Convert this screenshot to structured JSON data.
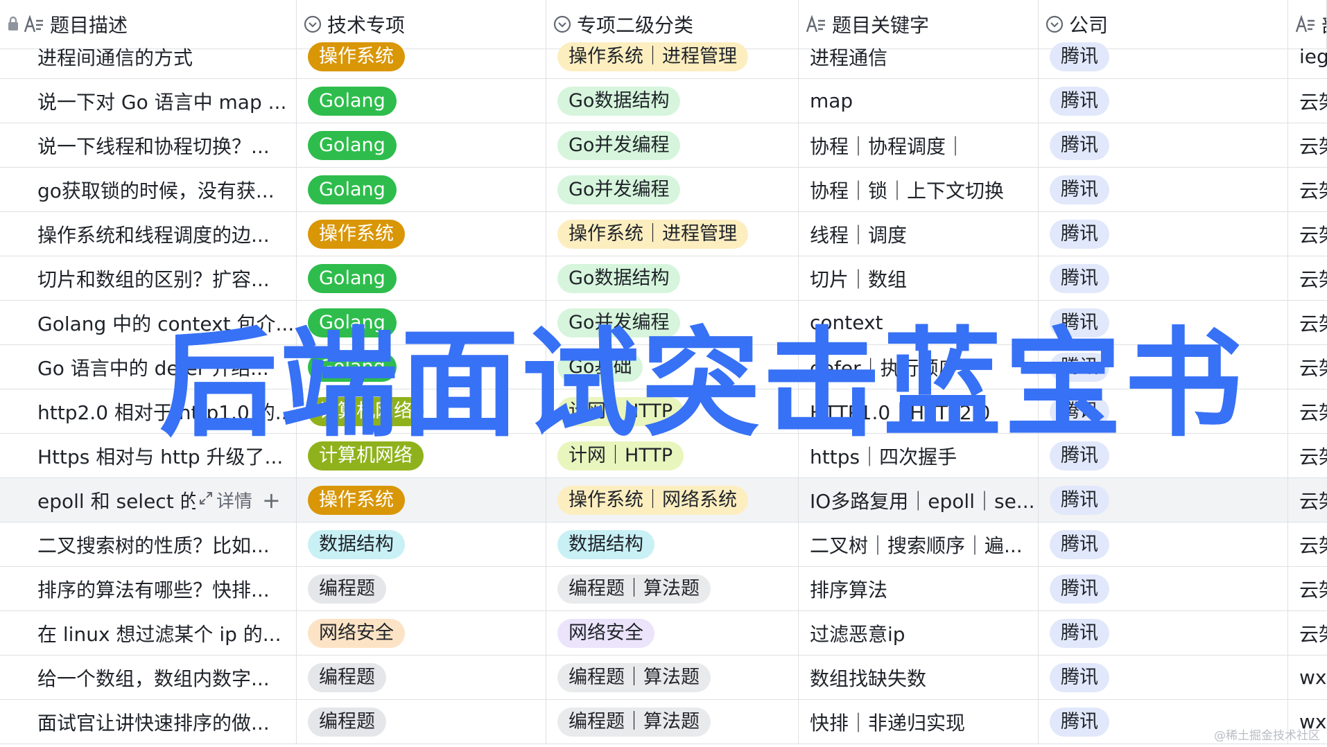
{
  "header": {
    "columns": [
      {
        "label": "题目描述",
        "icon": "text-field-icon",
        "locked": true
      },
      {
        "label": "技术专项",
        "icon": "single-select-icon"
      },
      {
        "label": "专项二级分类",
        "icon": "single-select-icon"
      },
      {
        "label": "题目关键字",
        "icon": "text-field-icon"
      },
      {
        "label": "公司",
        "icon": "single-select-icon"
      },
      {
        "label": "部",
        "icon": "text-field-icon"
      }
    ]
  },
  "hover_tools": {
    "detail_label": "详情",
    "add_label": "+"
  },
  "rows": [
    {
      "desc": "进程间通信的方式",
      "tech": "操作系统",
      "tech_kind": "os",
      "sub": "操作系统｜进程管理",
      "sub_kind": "os",
      "keywords": "进程通信",
      "company": "腾讯",
      "dept": "ieg"
    },
    {
      "desc": "说一下对 Go 语言中 map ...",
      "tech": "Golang",
      "tech_kind": "go",
      "sub": "Go数据结构",
      "sub_kind": "go",
      "keywords": "map",
      "company": "腾讯",
      "dept": "云架"
    },
    {
      "desc": "说一下线程和协程切换？...",
      "tech": "Golang",
      "tech_kind": "go",
      "sub": "Go并发编程",
      "sub_kind": "go",
      "keywords": "协程｜协程调度｜",
      "company": "腾讯",
      "dept": "云架"
    },
    {
      "desc": "go获取锁的时候，没有获...",
      "tech": "Golang",
      "tech_kind": "go",
      "sub": "Go并发编程",
      "sub_kind": "go",
      "keywords": "协程｜锁｜上下文切换",
      "company": "腾讯",
      "dept": "云架"
    },
    {
      "desc": "操作系统和线程调度的边...",
      "tech": "操作系统",
      "tech_kind": "os",
      "sub": "操作系统｜进程管理",
      "sub_kind": "os",
      "keywords": "线程｜调度",
      "company": "腾讯",
      "dept": "云架"
    },
    {
      "desc": "切片和数组的区别？扩容...",
      "tech": "Golang",
      "tech_kind": "go",
      "sub": "Go数据结构",
      "sub_kind": "go",
      "keywords": "切片｜数组",
      "company": "腾讯",
      "dept": "云架"
    },
    {
      "desc": "Golang 中的 context 包介...",
      "tech": "Golang",
      "tech_kind": "go",
      "sub": "Go并发编程",
      "sub_kind": "go",
      "keywords": "context",
      "company": "腾讯",
      "dept": "云架"
    },
    {
      "desc": "Go 语言中的 defer 介绍...",
      "tech": "Golang",
      "tech_kind": "go",
      "sub": "Go基础",
      "sub_kind": "go",
      "keywords": "defer｜执行顺序",
      "company": "腾讯",
      "dept": "云架"
    },
    {
      "desc": "http2.0 相对于 http1.0 的...",
      "tech": "计算机网络",
      "tech_kind": "net",
      "sub": "计网｜HTTP",
      "sub_kind": "net",
      "keywords": "HTTP1.0｜HTTP2.0",
      "company": "腾讯",
      "dept": "云架"
    },
    {
      "desc": "Https 相对与 http 升级了...",
      "tech": "计算机网络",
      "tech_kind": "net",
      "sub": "计网｜HTTP",
      "sub_kind": "net",
      "keywords": "https｜四次握手",
      "company": "腾讯",
      "dept": "云架"
    },
    {
      "desc": "epoll 和 select 的",
      "tech": "操作系统",
      "tech_kind": "os",
      "sub": "操作系统｜网络系统",
      "sub_kind": "os",
      "keywords": "IO多路复用｜epoll｜se...",
      "company": "腾讯",
      "dept": "云架",
      "hover": true
    },
    {
      "desc": "二叉搜索树的性质？比如...",
      "tech": "数据结构",
      "tech_kind": "ds",
      "sub": "数据结构",
      "sub_kind": "ds",
      "keywords": "二叉树｜搜索顺序｜遍...",
      "company": "腾讯",
      "dept": "云架"
    },
    {
      "desc": "排序的算法有哪些？快排...",
      "tech": "编程题",
      "tech_kind": "code",
      "sub": "编程题｜算法题",
      "sub_kind": "code",
      "keywords": "排序算法",
      "company": "腾讯",
      "dept": "云架"
    },
    {
      "desc": "在 linux 想过滤某个 ip 的...",
      "tech": "网络安全",
      "tech_kind": "sec",
      "sub": "网络安全",
      "sub_kind": "sec",
      "keywords": "过滤恶意ip",
      "company": "腾讯",
      "dept": "云架"
    },
    {
      "desc": "给一个数组，数组内数字...",
      "tech": "编程题",
      "tech_kind": "code",
      "sub": "编程题｜算法题",
      "sub_kind": "code",
      "keywords": "数组找缺失数",
      "company": "腾讯",
      "dept": "wxg"
    },
    {
      "desc": "面试官让讲快速排序的做...",
      "tech": "编程题",
      "tech_kind": "code",
      "sub": "编程题｜算法题",
      "sub_kind": "code",
      "keywords": "快排｜非递归实现",
      "company": "腾讯",
      "dept": "wxg"
    }
  ],
  "overlay_title": "后端面试突击蓝宝书",
  "watermark": "@稀土掘金技术社区"
}
